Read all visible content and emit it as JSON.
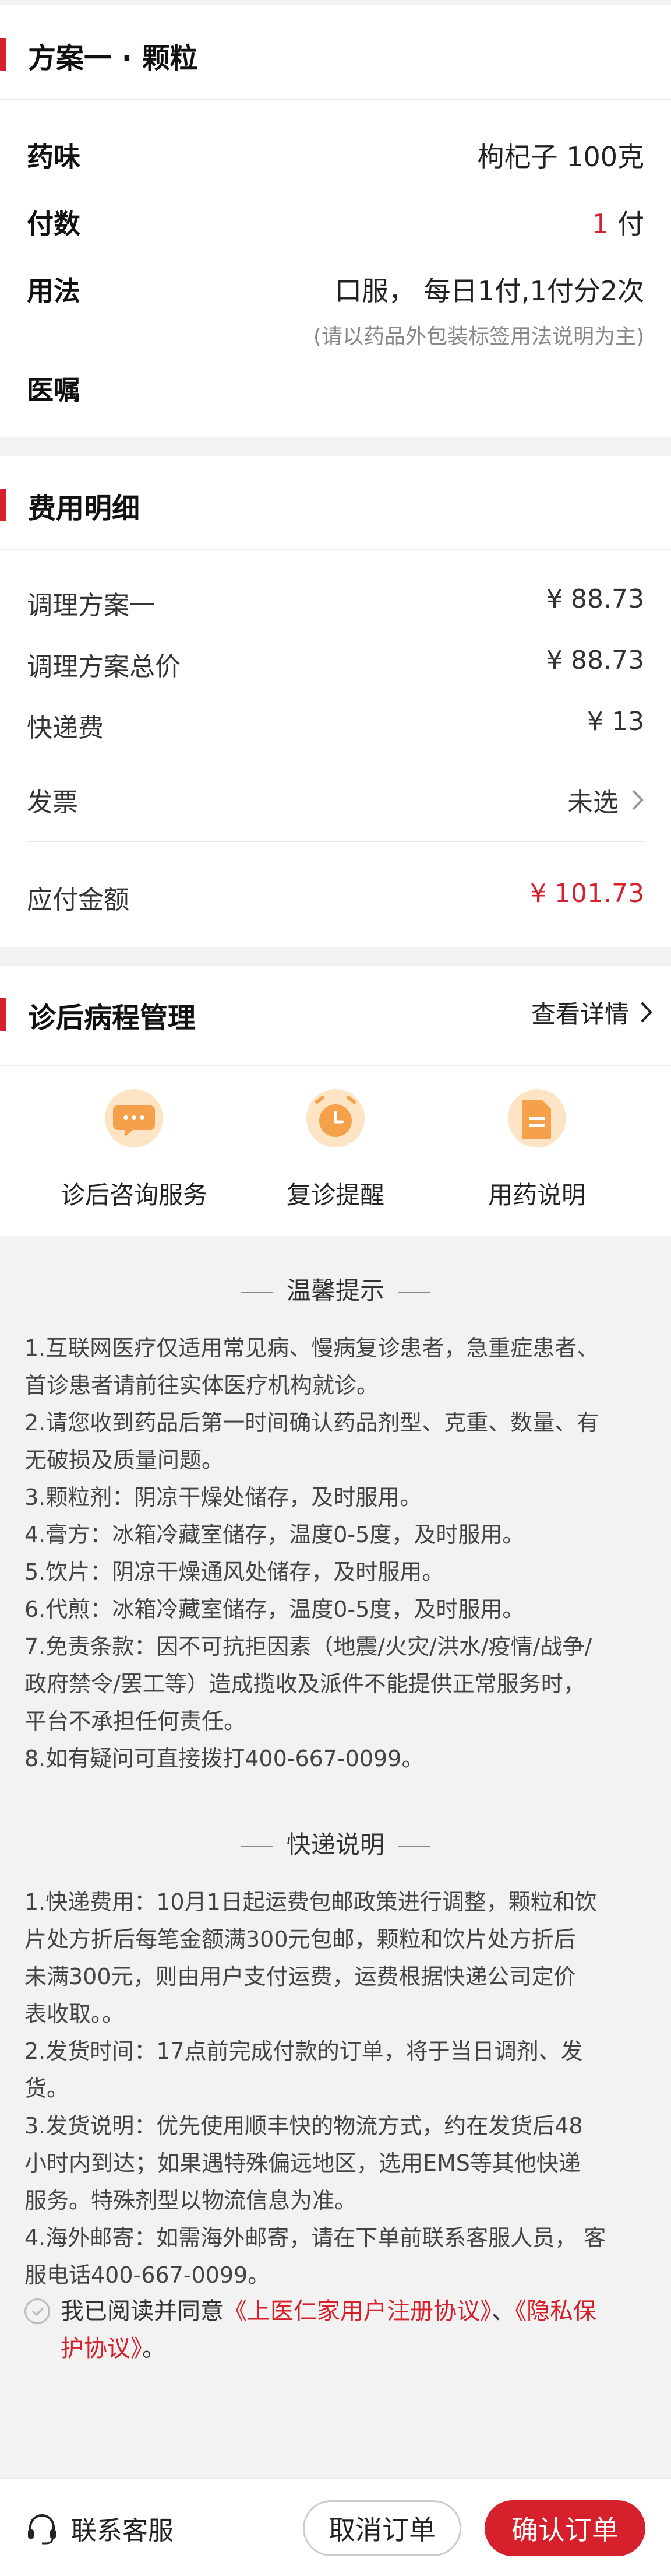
{
  "plan": {
    "title": "方案一 · 颗粒",
    "rows": [
      {
        "label": "药味",
        "value": "枸杞子 100克"
      },
      {
        "label": "付数",
        "value_num": "1",
        "value_unit": " 付"
      },
      {
        "label": "用法",
        "value": "口服， 每日1付,1付分2次",
        "note": "(请以药品外包装标签用法说明为主)"
      },
      {
        "label": "医嘱",
        "value": ""
      }
    ]
  },
  "fees": {
    "title": "费用明细",
    "rows": [
      {
        "label": "调理方案一",
        "value": "¥ 88.73"
      },
      {
        "label": "调理方案总价",
        "value": "¥ 88.73"
      },
      {
        "label": "快递费",
        "value": "¥ 13"
      },
      {
        "label": "发票",
        "value": "未选"
      }
    ],
    "total_label": "应付金额",
    "total_value": "¥ 101.73"
  },
  "course": {
    "title": "诊后病程管理",
    "link": "查看详情",
    "items": [
      {
        "label": "诊后咨询服务",
        "icon": "chat-bubble-icon"
      },
      {
        "label": "复诊提醒",
        "icon": "alarm-clock-icon"
      },
      {
        "label": "用药说明",
        "icon": "document-icon"
      }
    ]
  },
  "tips": {
    "title": "温馨提示",
    "lines": [
      "1.互联网医疗仅适用常见病、慢病复诊患者，急重症患者、",
      "   首诊患者请前往实体医疗机构就诊。",
      "2.请您收到药品后第一时间确认药品剂型、克重、数量、有",
      "   无破损及质量问题。",
      "3.颗粒剂：阴凉干燥处储存，及时服用。",
      "4.膏方：冰箱冷藏室储存，温度0-5度，及时服用。",
      "5.饮片：阴凉干燥通风处储存，及时服用。",
      "6.代煎：冰箱冷藏室储存，温度0-5度，及时服用。",
      "7.免责条款：因不可抗拒因素（地震/火灾/洪水/疫情/战争/",
      "   政府禁令/罢工等）造成揽收及派件不能提供正常服务时，",
      "   平台不承担任何责任。",
      "8.如有疑问可直接拨打400-667-0099。"
    ]
  },
  "express": {
    "title": "快递说明",
    "lines": [
      "1.快递费用：10月1日起运费包邮政策进行调整，颗粒和饮",
      "   片处方折后每笔金额满300元包邮，颗粒和饮片处方折后",
      "   未满300元，则由用户支付运费，运费根据快递公司定价",
      "   表收取。。",
      "2.发货时间：17点前完成付款的订单，将于当日调剂、发",
      "   货。",
      "3.发货说明：优先使用顺丰快的物流方式，约在发货后48",
      "   小时内到达；如果遇特殊偏远地区，选用EMS等其他快递",
      "   服务。特殊剂型以物流信息为准。",
      "4.海外邮寄：如需海外邮寄，请在下单前联系客服人员， 客",
      "   服电话400-667-0099。"
    ]
  },
  "agreement": {
    "prefix": "我已阅读并同意",
    "link1": "《上医仁家用户注册协议》",
    "sep": "、",
    "link2a": "《隐私保",
    "link2b": "护协议》",
    "suffix": "。"
  },
  "footer": {
    "service": "联系客服",
    "cancel": "取消订单",
    "confirm": "确认订单"
  }
}
